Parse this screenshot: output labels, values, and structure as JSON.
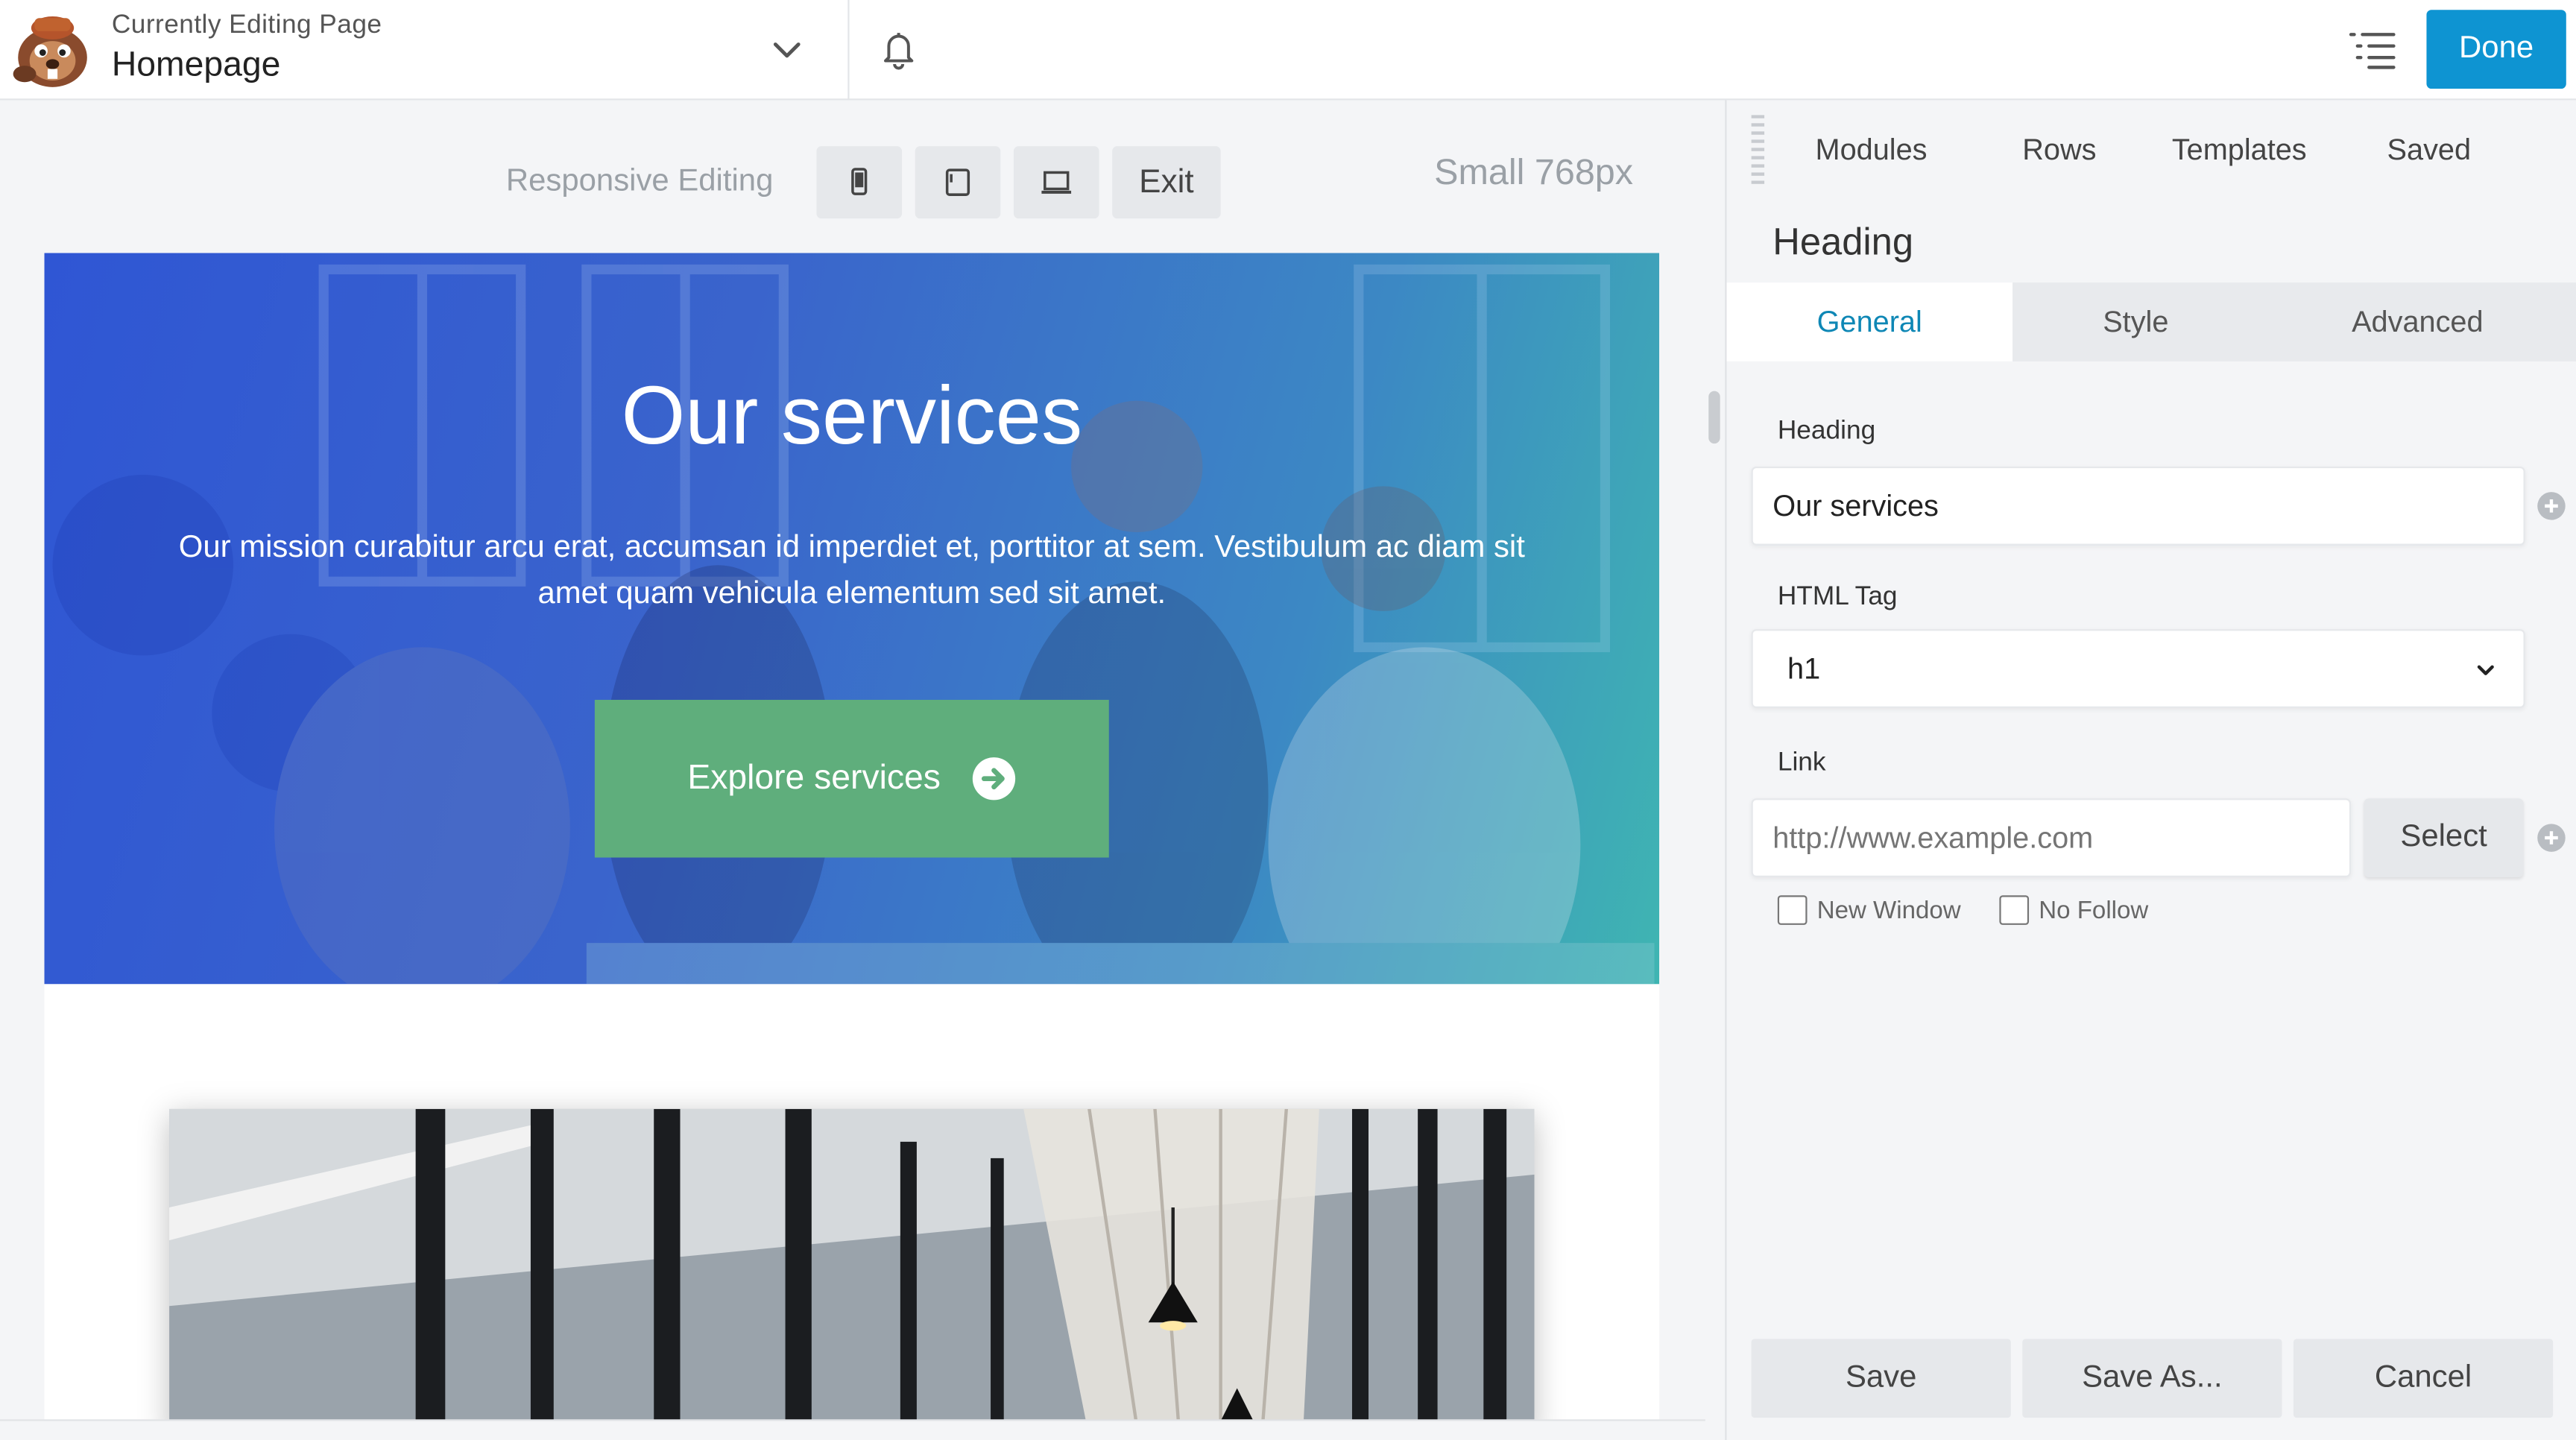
{
  "header": {
    "editing_label": "Currently Editing Page",
    "page_name": "Homepage",
    "done_label": "Done"
  },
  "responsive_bar": {
    "label": "Responsive Editing",
    "exit_label": "Exit",
    "size_label": "Small 768px"
  },
  "hero": {
    "title": "Our services",
    "text": "Our mission curabitur arcu erat, accumsan id imperdiet et, porttitor at sem. Vestibulum ac diam sit amet quam vehicula elementum sed sit amet.",
    "button_label": "Explore services"
  },
  "panel": {
    "tabs": [
      "Modules",
      "Rows",
      "Templates",
      "Saved"
    ],
    "module_title": "Heading",
    "settings_tabs": [
      "General",
      "Style",
      "Advanced"
    ],
    "active_settings_tab": "General",
    "fields": {
      "heading_label": "Heading",
      "heading_value": "Our services",
      "html_tag_label": "HTML Tag",
      "html_tag_value": "h1",
      "link_label": "Link",
      "link_placeholder": "http://www.example.com",
      "select_label": "Select",
      "new_window_label": "New Window",
      "no_follow_label": "No Follow"
    },
    "footer": {
      "save_label": "Save",
      "save_as_label": "Save As...",
      "cancel_label": "Cancel"
    }
  },
  "colors": {
    "accent": "#0e94d2",
    "cta": "#5fae7c",
    "active_tab_text": "#0e87b5"
  },
  "icons": [
    "beaver-logo-icon",
    "chevron-down-icon",
    "bell-icon",
    "outline-list-icon",
    "phone-icon",
    "tablet-icon",
    "laptop-icon",
    "arrow-circle-right-icon",
    "drag-grip-icon",
    "plus-circle-icon"
  ]
}
